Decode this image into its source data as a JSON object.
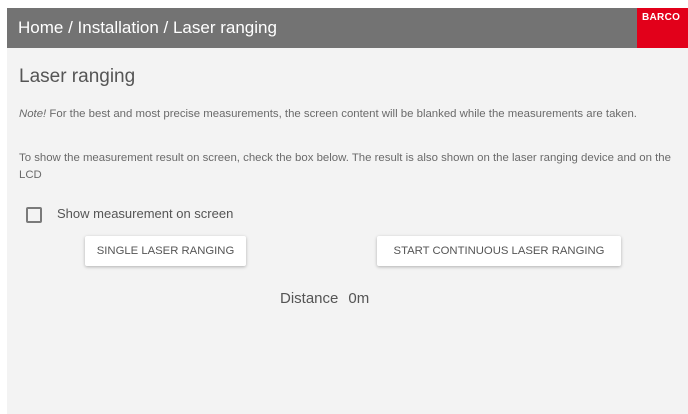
{
  "header": {
    "breadcrumb": "Home / Installation / Laser ranging",
    "brand_logo_text": "BARCO"
  },
  "page": {
    "title": "Laser ranging",
    "note_label": "Note!",
    "note_text": " For the best and most precise measurements, the screen content will be blanked while the measurements are taken.",
    "info_text": "To show the measurement result on screen, check the box below. The result is also shown on the laser ranging device and on the LCD"
  },
  "options": {
    "show_on_screen_label": "Show measurement on screen",
    "show_on_screen_checked": false
  },
  "actions": {
    "single_label": "SINGLE LASER RANGING",
    "continuous_label": "START CONTINUOUS LASER RANGING"
  },
  "result": {
    "distance_label": "Distance",
    "distance_value": "0m"
  },
  "colors": {
    "header_bg": "#737373",
    "brand_red": "#e2001a",
    "content_bg": "#f3f3f3"
  }
}
